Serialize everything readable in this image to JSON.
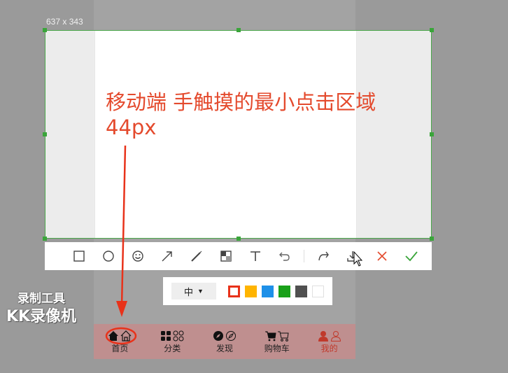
{
  "selection": {
    "dimensions_label": "637 x 343"
  },
  "annotation": {
    "line1": "移动端 手触摸的最小点击区域",
    "line2": "44px",
    "color": "#e44a2d"
  },
  "toolbar": {
    "tools": [
      "rectangle-icon",
      "ellipse-icon",
      "emoji-icon",
      "arrow-icon",
      "pen-icon",
      "mosaic-icon",
      "text-icon",
      "undo-icon",
      "redo-icon",
      "download-icon",
      "cancel-icon",
      "confirm-icon"
    ]
  },
  "text_options": {
    "size_value": "中",
    "colors": [
      "#e8321a",
      "#ffb400",
      "#1e90e8",
      "#1aa11a",
      "#505050",
      "#ffffff"
    ],
    "selected_color": "#e8321a"
  },
  "watermark": {
    "line1": "录制工具",
    "line2": "KK录像机"
  },
  "bottom_nav": {
    "items": [
      {
        "label": "首页",
        "icon": "home-icon"
      },
      {
        "label": "分类",
        "icon": "category-icon"
      },
      {
        "label": "发现",
        "icon": "discover-icon"
      },
      {
        "label": "购物车",
        "icon": "cart-icon"
      },
      {
        "label": "我的",
        "icon": "user-icon"
      }
    ],
    "active_color": "#c0392b"
  },
  "colors": {
    "selection_border": "#4aa84a",
    "arrow": "#e8321a",
    "confirm": "#3aa53a",
    "cancel": "#e44a2d"
  }
}
